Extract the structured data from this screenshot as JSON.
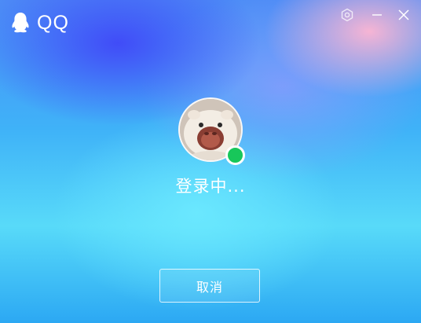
{
  "app": {
    "name": "QQ"
  },
  "window_controls": {
    "settings_icon": "gear-hexagon-icon",
    "minimize_icon": "minimize-icon",
    "close_icon": "close-icon"
  },
  "login": {
    "status_text": "登录中...",
    "online_status": "online",
    "status_color": "#18c75a"
  },
  "actions": {
    "cancel_label": "取消"
  },
  "colors": {
    "background_top": "#4048f8",
    "background_mid": "#3fb2f8",
    "background_light": "#6eebff",
    "accent_pink": "#ffb6d2",
    "text": "#ffffff"
  }
}
